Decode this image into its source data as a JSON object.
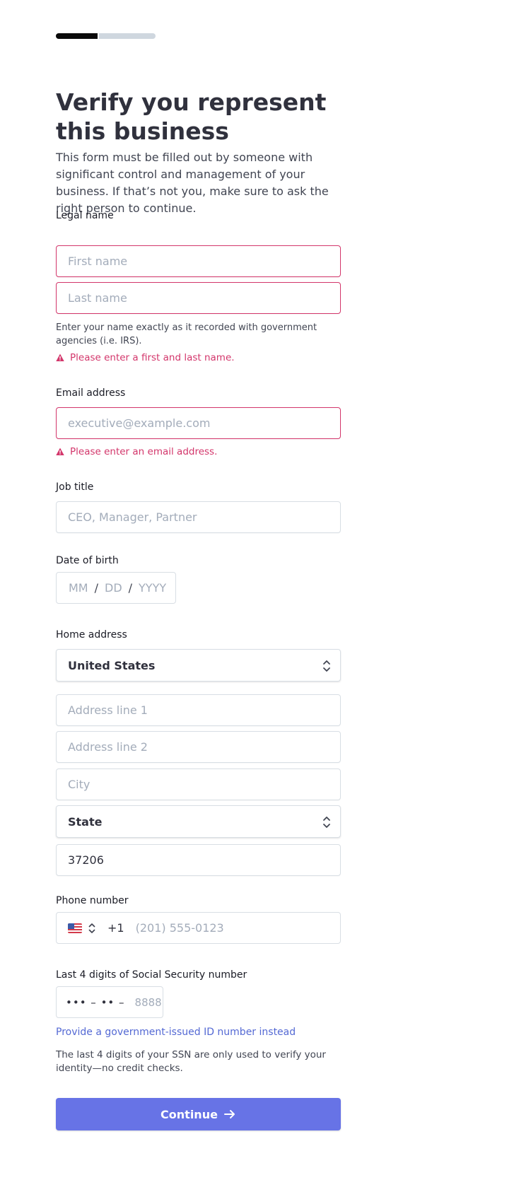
{
  "page": {
    "title": "Verify you represent this business",
    "intro": "This form must be filled out by someone with significant control and management of your business. If that’s not you, make sure to ask the right person to continue."
  },
  "progress": {
    "completed_fraction": 0.42
  },
  "legal_name": {
    "label": "Legal name",
    "first_placeholder": "First name",
    "last_placeholder": "Last name",
    "help": "Enter your name exactly as it recorded with government agencies (i.e. IRS).",
    "error": "Please enter a first and last name."
  },
  "email": {
    "label": "Email address",
    "placeholder": "executive@example.com",
    "error": "Please enter an email address."
  },
  "job_title": {
    "label": "Job title",
    "placeholder": "CEO, Manager, Partner"
  },
  "dob": {
    "label": "Date of birth",
    "month_placeholder": "MM",
    "day_placeholder": "DD",
    "year_placeholder": "YYYY",
    "separator": "/"
  },
  "home_address": {
    "label": "Home address",
    "country": "United States",
    "line1_placeholder": "Address line 1",
    "line2_placeholder": "Address line 2",
    "city_placeholder": "City",
    "state": "State",
    "zip": "37206"
  },
  "phone": {
    "label": "Phone number",
    "flag_icon": "us-flag-icon",
    "country_code": "+1",
    "placeholder": "(201) 555-0123"
  },
  "ssn": {
    "label": "Last 4 digits of Social Security number",
    "mask": "••• – •• –",
    "placeholder": "8888",
    "alt_link": "Provide a government-issued ID number instead",
    "help": "The last 4 digits of your SSN are only used to verify your identity—no credit checks."
  },
  "actions": {
    "continue_label": "Continue"
  },
  "colors": {
    "accent": "#6773e6",
    "link": "#5469d4",
    "error": "#d3366b",
    "progress_done": "#0a0a0a",
    "progress_todo": "#cfd7df"
  }
}
